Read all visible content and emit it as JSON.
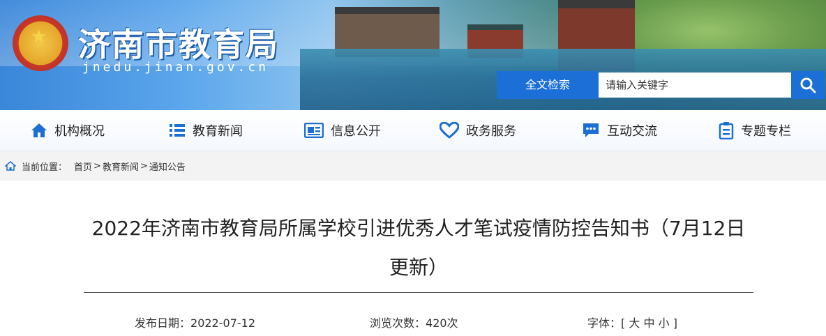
{
  "header": {
    "site_name": "济南市教育局",
    "domain": "jnedu.jinan.gov.cn",
    "search": {
      "label": "全文检索",
      "placeholder": "请输入关键字"
    }
  },
  "nav": [
    {
      "label": "机构概况",
      "icon": "home-icon"
    },
    {
      "label": "教育新闻",
      "icon": "list-icon"
    },
    {
      "label": "信息公开",
      "icon": "newspaper-icon"
    },
    {
      "label": "政务服务",
      "icon": "heart-icon"
    },
    {
      "label": "互动交流",
      "icon": "chat-icon"
    },
    {
      "label": "专题专栏",
      "icon": "clipboard-icon"
    }
  ],
  "breadcrumb": {
    "prefix": "当前位置：",
    "items": [
      "首页",
      "教育新闻",
      "通知公告"
    ],
    "separator": ">"
  },
  "article": {
    "title": "2022年济南市教育局所属学校引进优秀人才笔试疫情防控告知书（7月12日更新）",
    "publish_label": "发布日期：",
    "publish_date": "2022-07-12",
    "views_label": "浏览次数：",
    "views": "420次",
    "font_label": "字体：",
    "font_open": "[",
    "font_large": "大",
    "font_medium": "中",
    "font_small": "小",
    "font_close": "]"
  },
  "colors": {
    "accent": "#1b6fd6",
    "nav_icon": "#1c6fd1"
  }
}
